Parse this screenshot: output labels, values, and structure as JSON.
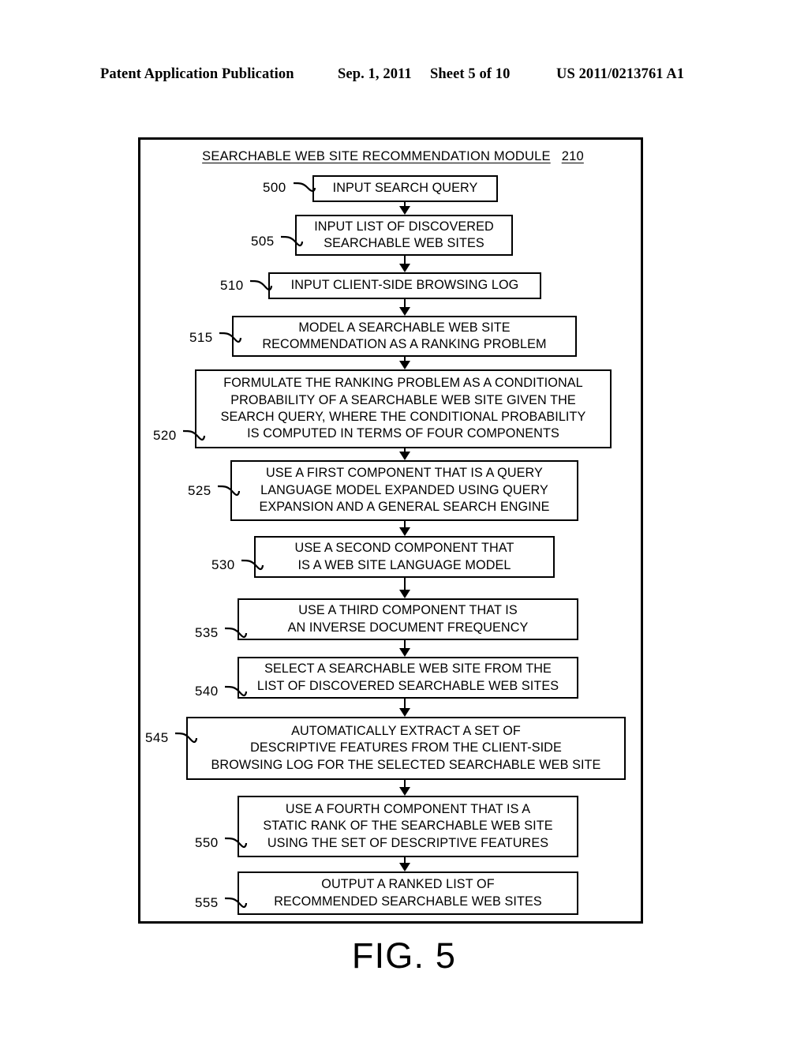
{
  "header": {
    "publication": "Patent Application Publication",
    "date": "Sep. 1, 2011",
    "sheet": "Sheet 5 of 10",
    "patent_number": "US 2011/0213761 A1"
  },
  "module": {
    "title": "SEARCHABLE WEB SITE RECOMMENDATION MODULE",
    "title_ref": "210"
  },
  "figure": {
    "caption": "FIG. 5"
  },
  "flow_steps": [
    {
      "ref": "500",
      "lines": [
        "INPUT SEARCH QUERY"
      ]
    },
    {
      "ref": "505",
      "lines": [
        "INPUT LIST OF DISCOVERED",
        "SEARCHABLE WEB SITES"
      ]
    },
    {
      "ref": "510",
      "lines": [
        "INPUT CLIENT-SIDE BROWSING LOG"
      ]
    },
    {
      "ref": "515",
      "lines": [
        "MODEL A SEARCHABLE WEB SITE",
        "RECOMMENDATION AS A RANKING PROBLEM"
      ]
    },
    {
      "ref": "520",
      "lines": [
        "FORMULATE THE RANKING PROBLEM AS A CONDITIONAL",
        "PROBABILITY OF A SEARCHABLE WEB SITE GIVEN THE",
        "SEARCH QUERY, WHERE THE CONDITIONAL PROBABILITY",
        "IS COMPUTED IN TERMS OF FOUR COMPONENTS"
      ]
    },
    {
      "ref": "525",
      "lines": [
        "USE A FIRST COMPONENT THAT IS A QUERY",
        "LANGUAGE MODEL EXPANDED USING QUERY",
        "EXPANSION AND A GENERAL SEARCH ENGINE"
      ]
    },
    {
      "ref": "530",
      "lines": [
        "USE A SECOND COMPONENT THAT",
        "IS A WEB SITE LANGUAGE MODEL"
      ]
    },
    {
      "ref": "535",
      "lines": [
        "USE A THIRD COMPONENT THAT IS",
        "AN INVERSE DOCUMENT FREQUENCY"
      ]
    },
    {
      "ref": "540",
      "lines": [
        "SELECT A SEARCHABLE WEB SITE FROM THE",
        "LIST OF DISCOVERED SEARCHABLE WEB SITES"
      ]
    },
    {
      "ref": "545",
      "lines": [
        "AUTOMATICALLY EXTRACT A SET OF",
        "DESCRIPTIVE FEATURES FROM THE CLIENT-SIDE",
        "BROWSING LOG FOR THE SELECTED SEARCHABLE WEB SITE"
      ]
    },
    {
      "ref": "550",
      "lines": [
        "USE A FOURTH COMPONENT THAT IS A",
        "STATIC RANK OF THE SEARCHABLE WEB SITE",
        "USING THE SET OF DESCRIPTIVE FEATURES"
      ]
    },
    {
      "ref": "555",
      "lines": [
        "OUTPUT A RANKED LIST OF",
        "RECOMMENDED SEARCHABLE WEB SITES"
      ]
    }
  ],
  "colors": {
    "ink": "#000000",
    "paper": "#ffffff"
  }
}
